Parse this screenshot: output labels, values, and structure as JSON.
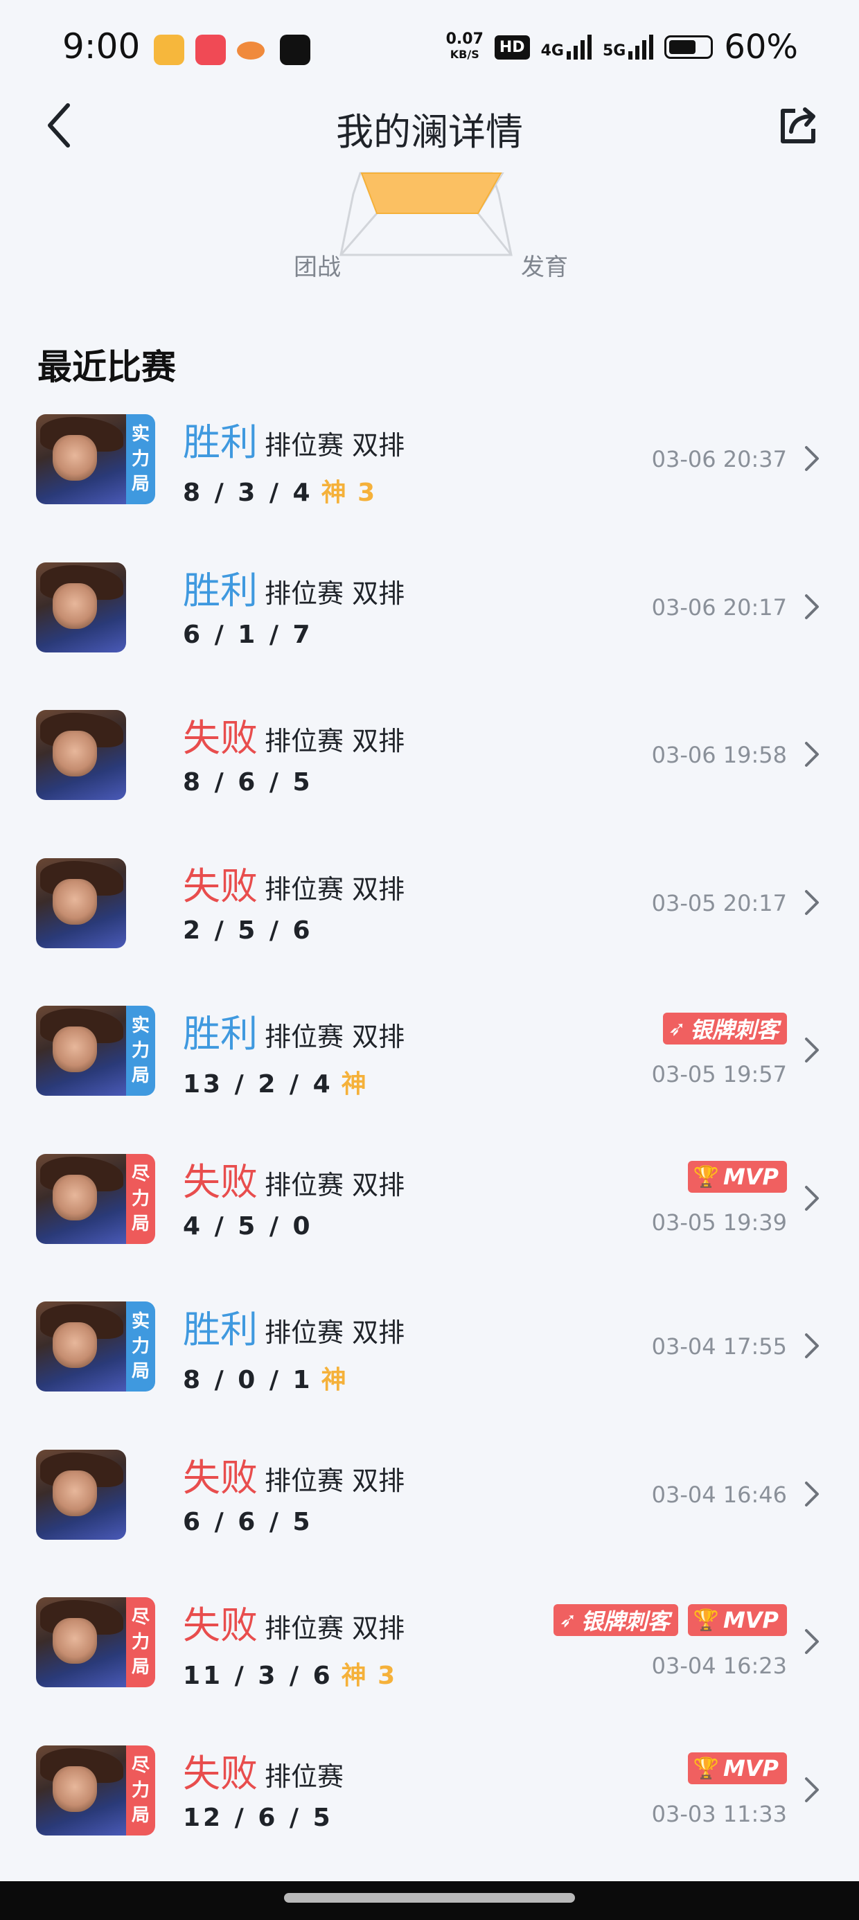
{
  "status_bar": {
    "time": "9:00",
    "net_speed_value": "0.07",
    "net_speed_unit": "KB/S",
    "hd_label": "HD",
    "network_1": "4G",
    "network_2": "5G",
    "battery_pct": "60%",
    "app_icons": [
      "music-app-icon",
      "shopping-app-icon",
      "game-app-icon",
      "tiktok-app-icon"
    ]
  },
  "header": {
    "title": "我的澜详情"
  },
  "radar": {
    "left_label": "团战",
    "right_label": "发育"
  },
  "recent_section": {
    "title": "最近比赛"
  },
  "matches": [
    {
      "result": "胜利",
      "outcome": "win",
      "mode": "排位赛 双排",
      "kda": "8 / 3 / 4",
      "god": "神 3",
      "time": "03-06 20:37",
      "tag": [
        "实",
        "力",
        "局"
      ],
      "tag_color": "blue",
      "badges": []
    },
    {
      "result": "胜利",
      "outcome": "win",
      "mode": "排位赛 双排",
      "kda": "6 / 1 / 7",
      "god": "",
      "time": "03-06 20:17",
      "tag": [],
      "tag_color": "",
      "badges": []
    },
    {
      "result": "失败",
      "outcome": "lose",
      "mode": "排位赛 双排",
      "kda": "8 / 6 / 5",
      "god": "",
      "time": "03-06 19:58",
      "tag": [],
      "tag_color": "",
      "badges": []
    },
    {
      "result": "失败",
      "outcome": "lose",
      "mode": "排位赛 双排",
      "kda": "2 / 5 / 6",
      "god": "",
      "time": "03-05 20:17",
      "tag": [],
      "tag_color": "",
      "badges": []
    },
    {
      "result": "胜利",
      "outcome": "win",
      "mode": "排位赛 双排",
      "kda": "13 / 2 / 4",
      "god": "神",
      "time": "03-05 19:57",
      "tag": [
        "实",
        "力",
        "局"
      ],
      "tag_color": "blue",
      "badges": [
        "银牌刺客"
      ]
    },
    {
      "result": "失败",
      "outcome": "lose",
      "mode": "排位赛 双排",
      "kda": "4 / 5 / 0",
      "god": "",
      "time": "03-05 19:39",
      "tag": [
        "尽",
        "力",
        "局"
      ],
      "tag_color": "red",
      "badges": [
        "MVP"
      ]
    },
    {
      "result": "胜利",
      "outcome": "win",
      "mode": "排位赛 双排",
      "kda": "8 / 0 / 1",
      "god": "神",
      "time": "03-04 17:55",
      "tag": [
        "实",
        "力",
        "局"
      ],
      "tag_color": "blue",
      "badges": []
    },
    {
      "result": "失败",
      "outcome": "lose",
      "mode": "排位赛 双排",
      "kda": "6 / 6 / 5",
      "god": "",
      "time": "03-04 16:46",
      "tag": [],
      "tag_color": "",
      "badges": []
    },
    {
      "result": "失败",
      "outcome": "lose",
      "mode": "排位赛 双排",
      "kda": "11 / 3 / 6",
      "god": "神 3",
      "time": "03-04 16:23",
      "tag": [
        "尽",
        "力",
        "局"
      ],
      "tag_color": "red",
      "badges": [
        "银牌刺客",
        "MVP"
      ]
    },
    {
      "result": "失败",
      "outcome": "lose",
      "mode": "排位赛",
      "kda": "12 / 6 / 5",
      "god": "",
      "time": "03-03 11:33",
      "tag": [
        "尽",
        "力",
        "局"
      ],
      "tag_color": "red",
      "badges": [
        "MVP"
      ]
    }
  ],
  "colors": {
    "win": "#3f99df",
    "lose": "#e84d4d",
    "god": "#f5b13a",
    "badge": "#f06060",
    "background": "#f4f6fa"
  }
}
